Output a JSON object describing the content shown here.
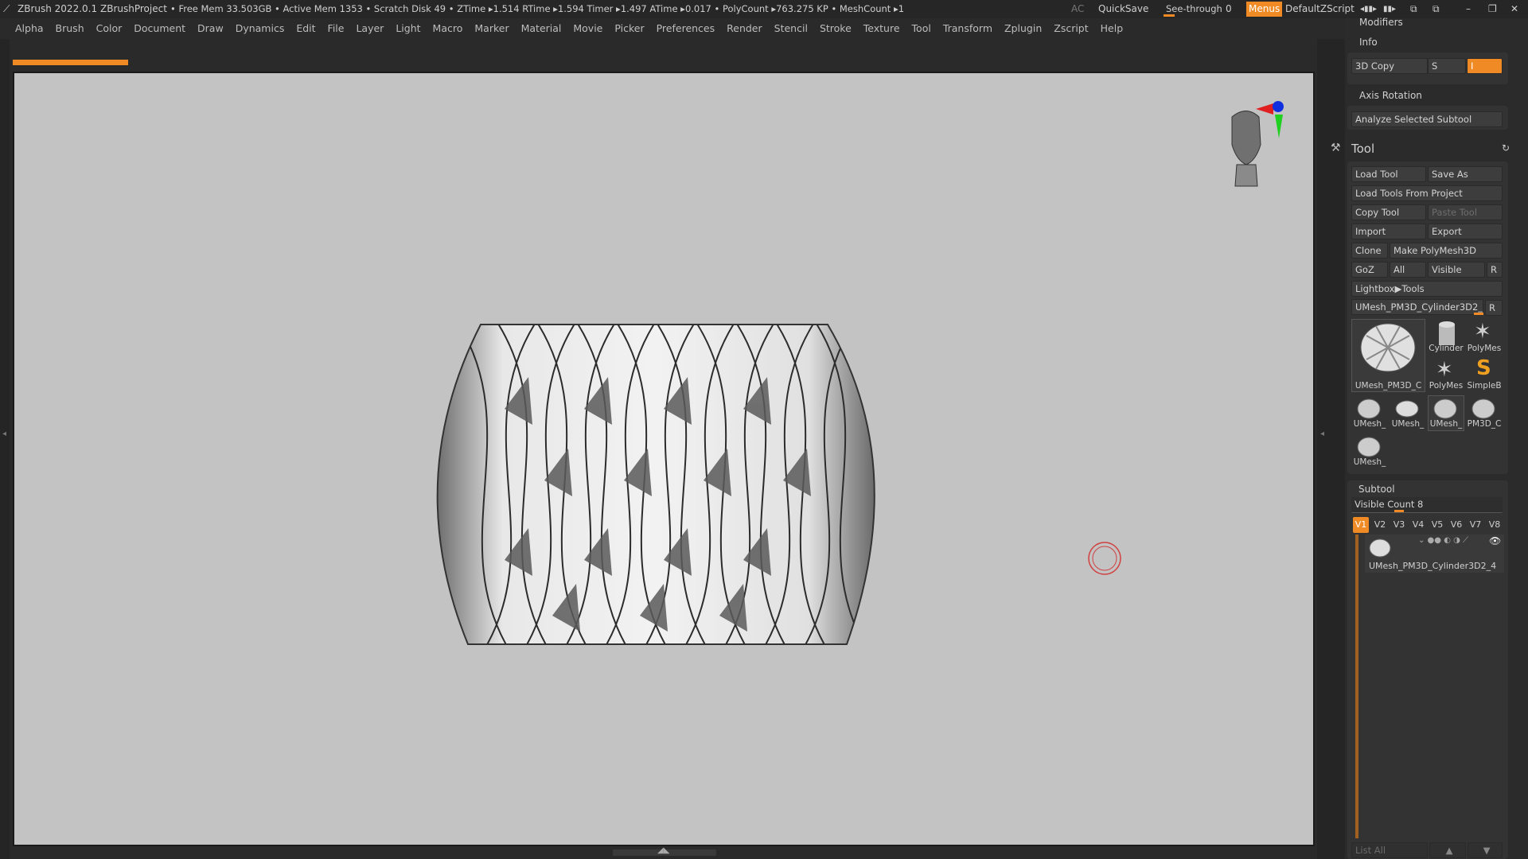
{
  "titlebar": {
    "app": "ZBrush 2022.0.1",
    "project": "ZBrushProject",
    "stats": "• Free Mem 33.503GB • Active Mem 1353 • Scratch Disk 49 • ZTime ▸1.514 RTime ▸1.594 Timer ▸1.497 ATime ▸0.017 • PolyCount ▸763.275 KP • MeshCount ▸1",
    "ac": "AC",
    "quicksave": "QuickSave",
    "seethrough_label": "See-through",
    "seethrough_value": "0",
    "menus": "Menus",
    "script": "DefaultZScript"
  },
  "menubar": [
    "Alpha",
    "Brush",
    "Color",
    "Document",
    "Draw",
    "Dynamics",
    "Edit",
    "File",
    "Layer",
    "Light",
    "Macro",
    "Marker",
    "Material",
    "Movie",
    "Picker",
    "Preferences",
    "Render",
    "Stencil",
    "Stroke",
    "Texture",
    "Tool",
    "Transform",
    "Zplugin",
    "Zscript",
    "Help"
  ],
  "right": {
    "modifiers": "Modifiers",
    "info": "Info",
    "copy3d": "3D Copy",
    "s": "S",
    "i": "I",
    "axis_rotation": "Axis Rotation",
    "analyze": "Analyze Selected Subtool",
    "tool_title": "Tool",
    "load_tool": "Load Tool",
    "save_as": "Save As",
    "load_from_project": "Load Tools From Project",
    "copy_tool": "Copy Tool",
    "paste_tool": "Paste Tool",
    "import": "Import",
    "export": "Export",
    "clone": "Clone",
    "make_polymesh": "Make PolyMesh3D",
    "goz": "GoZ",
    "all": "All",
    "visible": "Visible",
    "r": "R",
    "lightbox_tools": "Lightbox▶Tools",
    "current_tool": "UMesh_PM3D_Cylinder3D2_4",
    "thumbs": {
      "main": "UMesh_PM3D_C",
      "cylinder": "Cylinder",
      "polymesh1": "PolyMes",
      "polymesh2": "PolyMes",
      "simpleb": "SimpleB",
      "u1": "UMesh_",
      "u2": "UMesh_",
      "u3": "UMesh_",
      "pm3d": "PM3D_C",
      "u4": "UMesh_"
    },
    "subtool_title": "Subtool",
    "visible_count": "Visible Count 8",
    "versions": [
      "V1",
      "V2",
      "V3",
      "V4",
      "V5",
      "V6",
      "V7",
      "V8"
    ],
    "subtool_item": "UMesh_PM3D_Cylinder3D2_4",
    "list_all": "List All"
  },
  "colors": {
    "accent": "#f08a24",
    "canvas": "#c3c3c3",
    "panel": "#333333"
  }
}
